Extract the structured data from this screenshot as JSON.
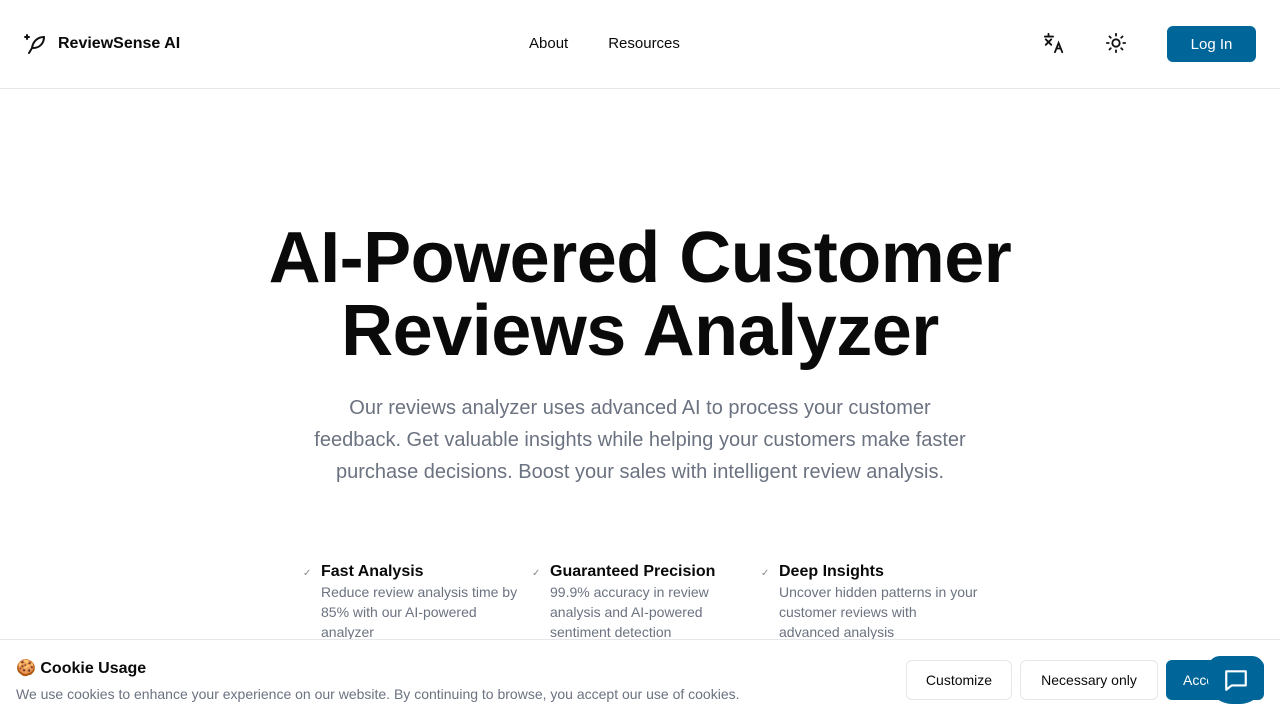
{
  "header": {
    "brand": "ReviewSense AI",
    "nav": [
      "About",
      "Resources"
    ],
    "login": "Log In"
  },
  "hero": {
    "title_line1": "AI-Powered Customer",
    "title_line2": "Reviews Analyzer",
    "subtitle": "Our reviews analyzer uses advanced AI to process your customer feedback. Get valuable insights while helping your customers make faster purchase decisions. Boost your sales with intelligent review analysis."
  },
  "features": [
    {
      "title": "Fast Analysis",
      "desc": "Reduce review analysis time by 85% with our AI-powered analyzer"
    },
    {
      "title": "Guaranteed Precision",
      "desc": "99.9% accuracy in review analysis and AI-powered sentiment detection"
    },
    {
      "title": "Deep Insights",
      "desc": "Uncover hidden patterns in your customer reviews with advanced analysis"
    }
  ],
  "cookie": {
    "title": "🍪 Cookie Usage",
    "text": "We use cookies to enhance your experience on our website. By continuing to browse, you accept our use of cookies.",
    "customize": "Customize",
    "necessary": "Necessary only",
    "accept": "Accept"
  },
  "colors": {
    "accent": "#006699"
  }
}
